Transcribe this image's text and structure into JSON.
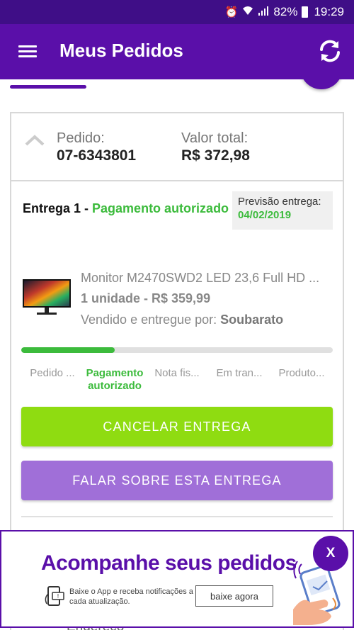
{
  "status_bar": {
    "battery": "82%",
    "time": "19:29"
  },
  "app_bar": {
    "title": "Meus Pedidos"
  },
  "order": {
    "order_label": "Pedido:",
    "order_number": "07-6343801",
    "total_label": "Valor total:",
    "total_value": "R$ 372,98"
  },
  "delivery": {
    "title": "Entrega 1 - ",
    "status": "Pagamento autorizado",
    "forecast_label": "Previsão entrega:",
    "forecast_date": "04/02/2019"
  },
  "product": {
    "name": "Monitor M2470SWD2 LED 23,6 Full HD ...",
    "quantity_price": "1 unidade - R$ 359,99",
    "seller_prefix": "Vendido e entregue por: ",
    "seller": "Soubarato"
  },
  "progress": {
    "fraction": 0.3
  },
  "steps": [
    "Pedido ...",
    "Pagamento autorizado",
    "Nota fis...",
    "Em tran...",
    "Produto..."
  ],
  "buttons": {
    "cancel": "CANCELAR ENTREGA",
    "talk": "FALAR SOBRE ESTA ENTREGA"
  },
  "banner": {
    "title": "Acompanhe seus pedidos",
    "text": "Baixe o App e receba notificações a cada atualização.",
    "button": "baixe agora",
    "close": "X"
  },
  "peek": {
    "text": "Endereço"
  },
  "colors": {
    "primary": "#5a0fa9",
    "status_bar": "#3f0e87",
    "green": "#3cbb3c",
    "cancel": "#8fdc11",
    "talk": "#a06fd8"
  }
}
